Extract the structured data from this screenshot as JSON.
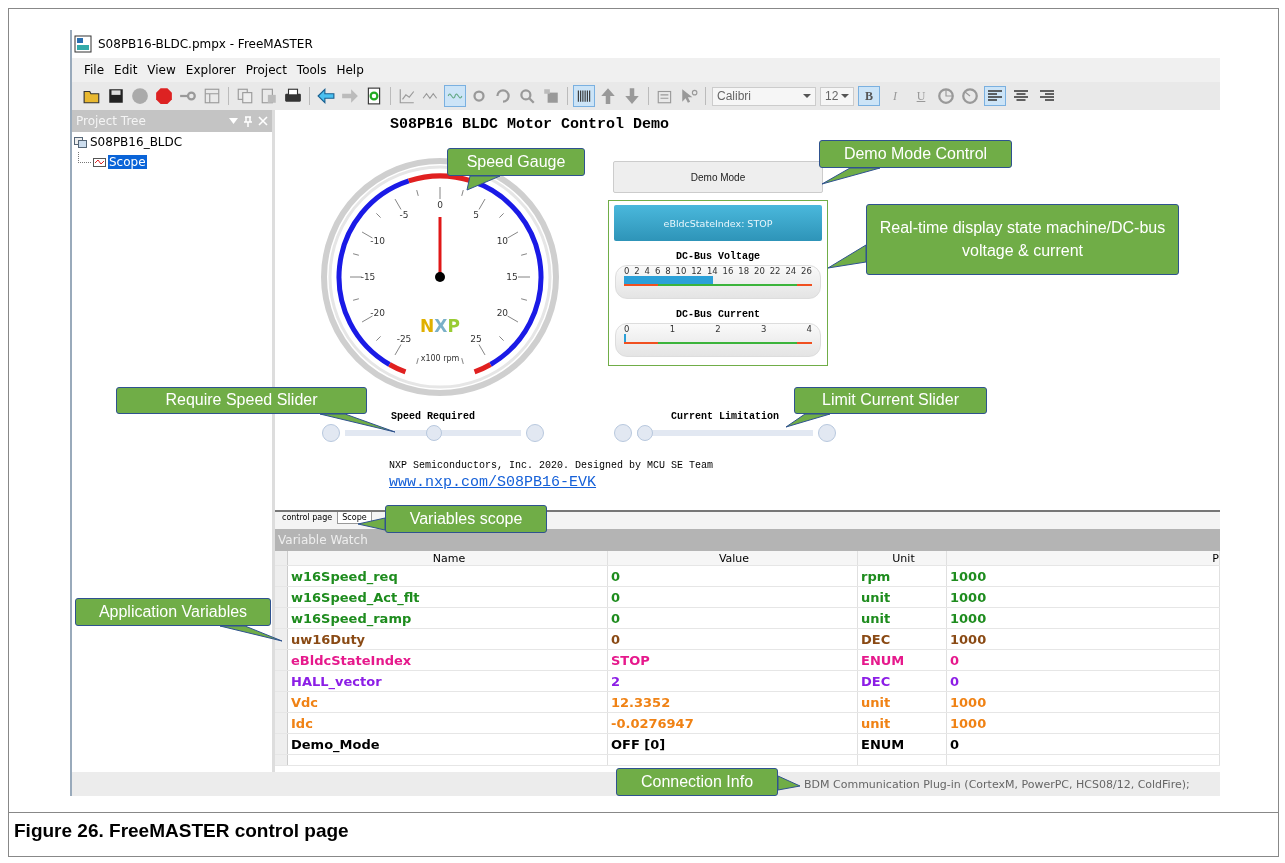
{
  "window": {
    "title": "S08PB16-BLDC.pmpx - FreeMASTER"
  },
  "menu": [
    "File",
    "Edit",
    "View",
    "Explorer",
    "Project",
    "Tools",
    "Help"
  ],
  "toolbar": {
    "font": "Calibri",
    "size": "12",
    "format_buttons": [
      {
        "label": "B",
        "selected": true
      },
      {
        "label": "I",
        "selected": false
      },
      {
        "label": "U",
        "selected": false
      }
    ],
    "align_buttons": [
      {
        "kind": "left",
        "selected": true
      },
      {
        "kind": "center",
        "selected": false
      },
      {
        "kind": "right",
        "selected": false
      }
    ]
  },
  "project_tree": {
    "title": "Project Tree",
    "items": [
      {
        "label": "S08PB16_BLDC",
        "selected": false,
        "children": [
          {
            "label": "Scope",
            "selected": true
          }
        ]
      }
    ]
  },
  "control_page": {
    "title": "S08PB16 BLDC Motor Control Demo",
    "gauge": {
      "scale": [
        "-25",
        "-20",
        "-15",
        "-10",
        "-5",
        "0",
        "5",
        "10",
        "15",
        "20",
        "25"
      ],
      "unit": "x100 rpm",
      "logo": "NXP",
      "level": 0.5
    },
    "demo_button": "Demo Mode",
    "state_display": "eBldcStateIndex: STOP",
    "voltage_bar": {
      "title": "DC-Bus Voltage",
      "scale": [
        "0",
        "2",
        "4",
        "6",
        "8",
        "10",
        "12",
        "14",
        "16",
        "18",
        "20",
        "22",
        "24",
        "26"
      ],
      "level": 0.475
    },
    "current_bar": {
      "title": "DC-Bus Current",
      "scale": [
        "0",
        "1",
        "2",
        "3",
        "4"
      ],
      "level": 0.01
    },
    "sliders": [
      {
        "label": "Speed Required",
        "level": 0.5
      },
      {
        "label": "Current Limitation",
        "level": 0.0
      }
    ],
    "footer": "NXP Semiconductors, Inc. 2020. Designed by MCU SE Team",
    "link": "www.nxp.com/S08PB16-EVK"
  },
  "tabs": [
    {
      "label": "control page",
      "selected": true
    },
    {
      "label": "Scope",
      "selected": false
    }
  ],
  "variable_watch": {
    "title": "Variable Watch",
    "columns": [
      "Name",
      "Value",
      "Unit",
      "P"
    ],
    "rows": [
      {
        "cells": [
          "w16Speed_req",
          "0",
          "rpm",
          "1000"
        ],
        "color": "#1e8c1e"
      },
      {
        "cells": [
          "w16Speed_Act_flt",
          "0",
          "unit",
          "1000"
        ],
        "color": "#1e8c1e"
      },
      {
        "cells": [
          "w16Speed_ramp",
          "0",
          "unit",
          "1000"
        ],
        "color": "#1e8c1e"
      },
      {
        "cells": [
          "uw16Duty",
          "0",
          "DEC",
          "1000"
        ],
        "color": "#8a4a14"
      },
      {
        "cells": [
          "eBldcStateIndex",
          "STOP",
          "ENUM",
          "0"
        ],
        "color": "#e6198c"
      },
      {
        "cells": [
          "HALL_vector",
          "2",
          "DEC",
          "0"
        ],
        "color": "#8c1ee6"
      },
      {
        "cells": [
          "Vdc",
          "12.3352",
          "unit",
          "1000"
        ],
        "color": "#f08214"
      },
      {
        "cells": [
          "Idc",
          "-0.0276947",
          "unit",
          "1000"
        ],
        "color": "#f08214"
      },
      {
        "cells": [
          "Demo_Mode",
          "OFF [0]",
          "ENUM",
          "0"
        ],
        "color": "#000000"
      }
    ]
  },
  "status_bar": "BDM Communication Plug-in (CortexM, PowerPC, HCS08/12, ColdFire);",
  "callouts": [
    {
      "text": "Speed Gauge"
    },
    {
      "text": "Demo Mode Control"
    },
    {
      "text": "Real-time display state machine/DC-bus voltage & current"
    },
    {
      "text": "Require Speed Slider"
    },
    {
      "text": "Limit Current Slider"
    },
    {
      "text": "Variables scope"
    },
    {
      "text": "Application Variables"
    },
    {
      "text": "Connection Info"
    }
  ],
  "caption": "Figure 26.  FreeMASTER control page"
}
